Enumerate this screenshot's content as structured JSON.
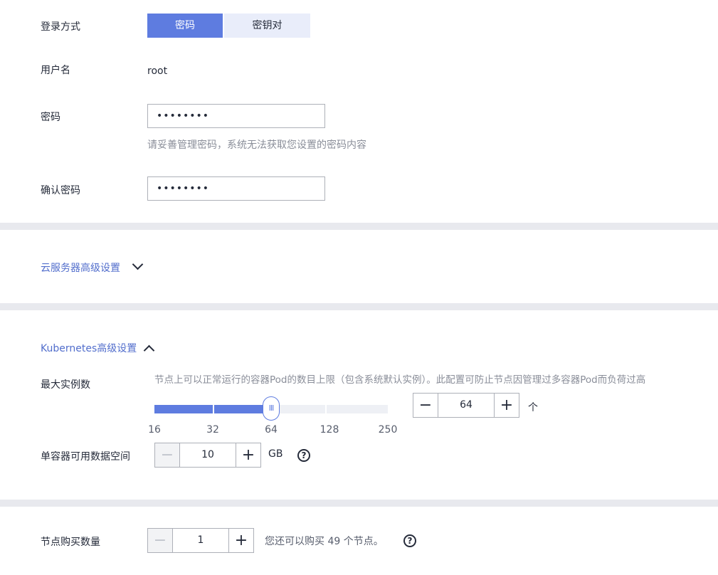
{
  "login": {
    "label": "登录方式",
    "options": [
      "密码",
      "密钥对"
    ],
    "selected": "密码"
  },
  "username": {
    "label": "用户名",
    "value": "root"
  },
  "password": {
    "label": "密码",
    "value": "••••••••",
    "hint": "请妥善管理密码，系统无法获取您设置的密码内容"
  },
  "confirm_password": {
    "label": "确认密码",
    "value": "••••••••"
  },
  "cloud_advanced": {
    "label": "云服务器高级设置",
    "expanded": false,
    "icon": "chevron-down-icon"
  },
  "kubernetes_advanced": {
    "label": "Kubernetes高级设置",
    "expanded": true,
    "icon": "chevron-up-icon",
    "max_instances": {
      "label": "最大实例数",
      "description": "节点上可以正常运行的容器Pod的数目上限（包含系统默认实例）。此配置可防止节点因管理过多容器Pod而负荷过高",
      "slider_marks": [
        "16",
        "32",
        "64",
        "128",
        "250"
      ],
      "slider_value": "64",
      "slider_handle": "Ⅲ",
      "stepper_value": "64",
      "unit": "个"
    },
    "container_storage": {
      "label": "单容器可用数据空间",
      "value": "10",
      "unit": "GB"
    }
  },
  "node_count": {
    "label": "节点购买数量",
    "value": "1",
    "note": "您还可以购买 49 个节点。"
  },
  "colors": {
    "accent": "#5e7ce0",
    "accent_light": "#e9edfa",
    "link": "#526ecc",
    "hint": "#8a8e99",
    "background": "#e8e9ee"
  }
}
